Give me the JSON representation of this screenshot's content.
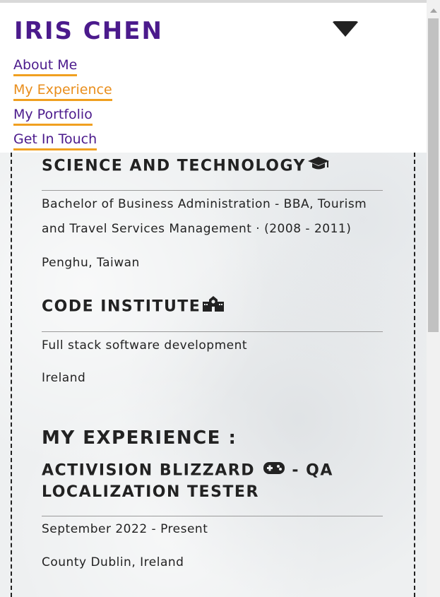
{
  "header": {
    "brand": "IRIS CHEN",
    "nav": [
      {
        "label": "About Me"
      },
      {
        "label": "My Experience"
      },
      {
        "label": "My Portfolio"
      },
      {
        "label": "Get In Touch"
      }
    ],
    "active_item": "My Experience",
    "toggle_icon": "caret-down-icon"
  },
  "education": [
    {
      "title": "SCIENCE AND TECHNOLOGY",
      "icon": "graduation-cap-icon",
      "lines": [
        "Bachelor of Business Administration - BBA, Tourism and Travel Services Management · (2008 - 2011)",
        "Penghu, Taiwan"
      ]
    },
    {
      "title": "CODE INSTITUTE",
      "icon": "school-icon",
      "lines": [
        "Full stack software development",
        "Ireland"
      ]
    }
  ],
  "experience": {
    "heading": "MY EXPERIENCE :",
    "jobs": [
      {
        "title_before_icon": "ACTIVISION BLIZZARD",
        "icon": "gamepad-icon",
        "title_after_icon": "- QA LOCALIZATION TESTER",
        "dates": "September 2022 - Present",
        "location": "County Dublin, Ireland"
      }
    ]
  },
  "colors": {
    "brand": "#4b1a8c",
    "accent": "#f0a020",
    "active": "#e98e1c",
    "text": "#222222"
  }
}
